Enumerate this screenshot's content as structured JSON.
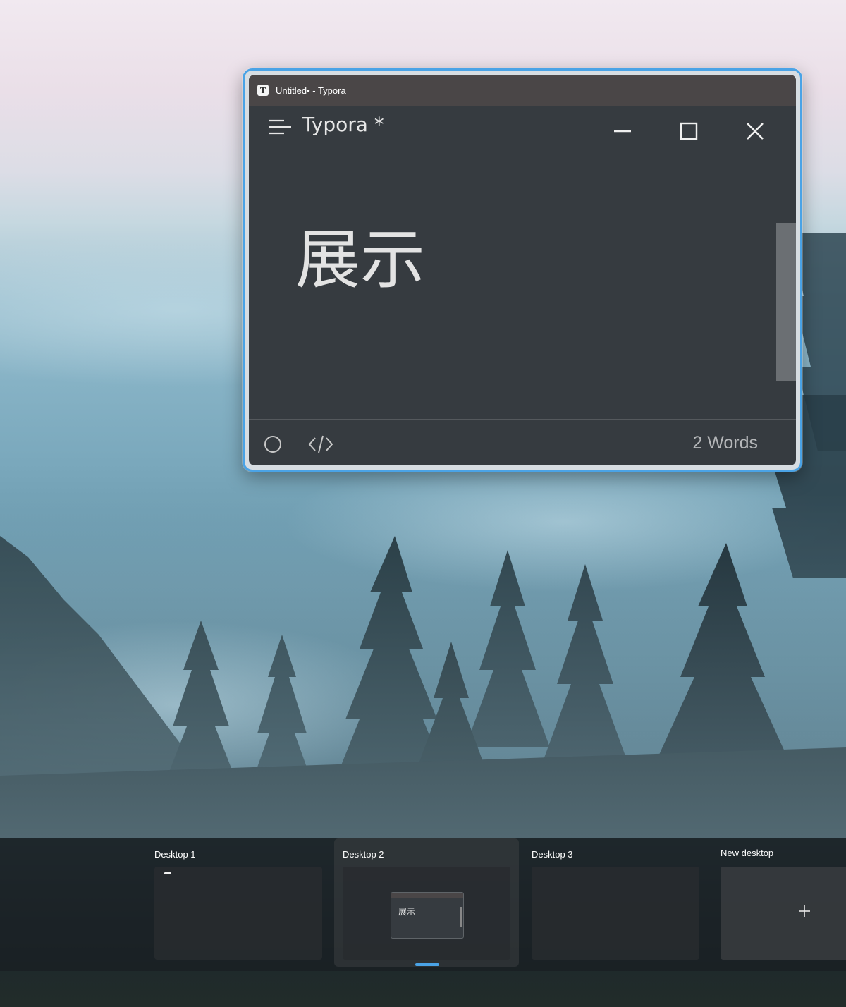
{
  "window": {
    "title": "Untitled• - Typora",
    "app_icon_letter": "T",
    "app_title": "Typora *",
    "editor_heading": "展示",
    "word_count": "2 Words",
    "icons": {
      "menu": "hamburger-menu-icon",
      "minimize": "minimize-icon",
      "maximize": "maximize-icon",
      "close": "close-icon",
      "focus_mode": "circle-icon",
      "source_code_mode": "code-icon"
    }
  },
  "task_view": {
    "desktops": [
      {
        "label": "Desktop 1",
        "active": false
      },
      {
        "label": "Desktop 2",
        "active": true,
        "thumbnail_heading": "展示"
      },
      {
        "label": "Desktop 3",
        "active": false
      }
    ],
    "new_desktop_label": "New desktop",
    "new_desktop_icon": "plus-icon"
  },
  "colors": {
    "accent": "#4aa3e6",
    "editor_background": "#363b40",
    "titlebar_background": "#4a4647"
  }
}
